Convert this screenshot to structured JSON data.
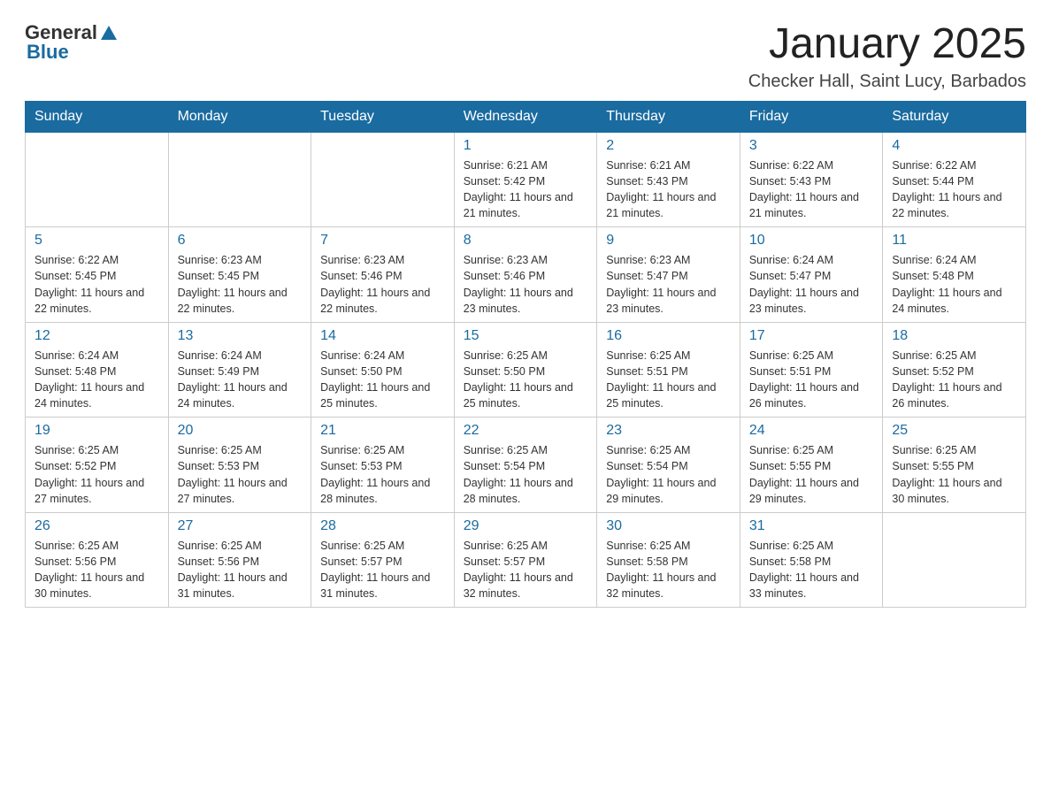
{
  "header": {
    "logo_general": "General",
    "logo_blue": "Blue",
    "month_title": "January 2025",
    "location": "Checker Hall, Saint Lucy, Barbados"
  },
  "days_of_week": [
    "Sunday",
    "Monday",
    "Tuesday",
    "Wednesday",
    "Thursday",
    "Friday",
    "Saturday"
  ],
  "weeks": [
    [
      {
        "day": "",
        "info": ""
      },
      {
        "day": "",
        "info": ""
      },
      {
        "day": "",
        "info": ""
      },
      {
        "day": "1",
        "info": "Sunrise: 6:21 AM\nSunset: 5:42 PM\nDaylight: 11 hours and 21 minutes."
      },
      {
        "day": "2",
        "info": "Sunrise: 6:21 AM\nSunset: 5:43 PM\nDaylight: 11 hours and 21 minutes."
      },
      {
        "day": "3",
        "info": "Sunrise: 6:22 AM\nSunset: 5:43 PM\nDaylight: 11 hours and 21 minutes."
      },
      {
        "day": "4",
        "info": "Sunrise: 6:22 AM\nSunset: 5:44 PM\nDaylight: 11 hours and 22 minutes."
      }
    ],
    [
      {
        "day": "5",
        "info": "Sunrise: 6:22 AM\nSunset: 5:45 PM\nDaylight: 11 hours and 22 minutes."
      },
      {
        "day": "6",
        "info": "Sunrise: 6:23 AM\nSunset: 5:45 PM\nDaylight: 11 hours and 22 minutes."
      },
      {
        "day": "7",
        "info": "Sunrise: 6:23 AM\nSunset: 5:46 PM\nDaylight: 11 hours and 22 minutes."
      },
      {
        "day": "8",
        "info": "Sunrise: 6:23 AM\nSunset: 5:46 PM\nDaylight: 11 hours and 23 minutes."
      },
      {
        "day": "9",
        "info": "Sunrise: 6:23 AM\nSunset: 5:47 PM\nDaylight: 11 hours and 23 minutes."
      },
      {
        "day": "10",
        "info": "Sunrise: 6:24 AM\nSunset: 5:47 PM\nDaylight: 11 hours and 23 minutes."
      },
      {
        "day": "11",
        "info": "Sunrise: 6:24 AM\nSunset: 5:48 PM\nDaylight: 11 hours and 24 minutes."
      }
    ],
    [
      {
        "day": "12",
        "info": "Sunrise: 6:24 AM\nSunset: 5:48 PM\nDaylight: 11 hours and 24 minutes."
      },
      {
        "day": "13",
        "info": "Sunrise: 6:24 AM\nSunset: 5:49 PM\nDaylight: 11 hours and 24 minutes."
      },
      {
        "day": "14",
        "info": "Sunrise: 6:24 AM\nSunset: 5:50 PM\nDaylight: 11 hours and 25 minutes."
      },
      {
        "day": "15",
        "info": "Sunrise: 6:25 AM\nSunset: 5:50 PM\nDaylight: 11 hours and 25 minutes."
      },
      {
        "day": "16",
        "info": "Sunrise: 6:25 AM\nSunset: 5:51 PM\nDaylight: 11 hours and 25 minutes."
      },
      {
        "day": "17",
        "info": "Sunrise: 6:25 AM\nSunset: 5:51 PM\nDaylight: 11 hours and 26 minutes."
      },
      {
        "day": "18",
        "info": "Sunrise: 6:25 AM\nSunset: 5:52 PM\nDaylight: 11 hours and 26 minutes."
      }
    ],
    [
      {
        "day": "19",
        "info": "Sunrise: 6:25 AM\nSunset: 5:52 PM\nDaylight: 11 hours and 27 minutes."
      },
      {
        "day": "20",
        "info": "Sunrise: 6:25 AM\nSunset: 5:53 PM\nDaylight: 11 hours and 27 minutes."
      },
      {
        "day": "21",
        "info": "Sunrise: 6:25 AM\nSunset: 5:53 PM\nDaylight: 11 hours and 28 minutes."
      },
      {
        "day": "22",
        "info": "Sunrise: 6:25 AM\nSunset: 5:54 PM\nDaylight: 11 hours and 28 minutes."
      },
      {
        "day": "23",
        "info": "Sunrise: 6:25 AM\nSunset: 5:54 PM\nDaylight: 11 hours and 29 minutes."
      },
      {
        "day": "24",
        "info": "Sunrise: 6:25 AM\nSunset: 5:55 PM\nDaylight: 11 hours and 29 minutes."
      },
      {
        "day": "25",
        "info": "Sunrise: 6:25 AM\nSunset: 5:55 PM\nDaylight: 11 hours and 30 minutes."
      }
    ],
    [
      {
        "day": "26",
        "info": "Sunrise: 6:25 AM\nSunset: 5:56 PM\nDaylight: 11 hours and 30 minutes."
      },
      {
        "day": "27",
        "info": "Sunrise: 6:25 AM\nSunset: 5:56 PM\nDaylight: 11 hours and 31 minutes."
      },
      {
        "day": "28",
        "info": "Sunrise: 6:25 AM\nSunset: 5:57 PM\nDaylight: 11 hours and 31 minutes."
      },
      {
        "day": "29",
        "info": "Sunrise: 6:25 AM\nSunset: 5:57 PM\nDaylight: 11 hours and 32 minutes."
      },
      {
        "day": "30",
        "info": "Sunrise: 6:25 AM\nSunset: 5:58 PM\nDaylight: 11 hours and 32 minutes."
      },
      {
        "day": "31",
        "info": "Sunrise: 6:25 AM\nSunset: 5:58 PM\nDaylight: 11 hours and 33 minutes."
      },
      {
        "day": "",
        "info": ""
      }
    ]
  ]
}
